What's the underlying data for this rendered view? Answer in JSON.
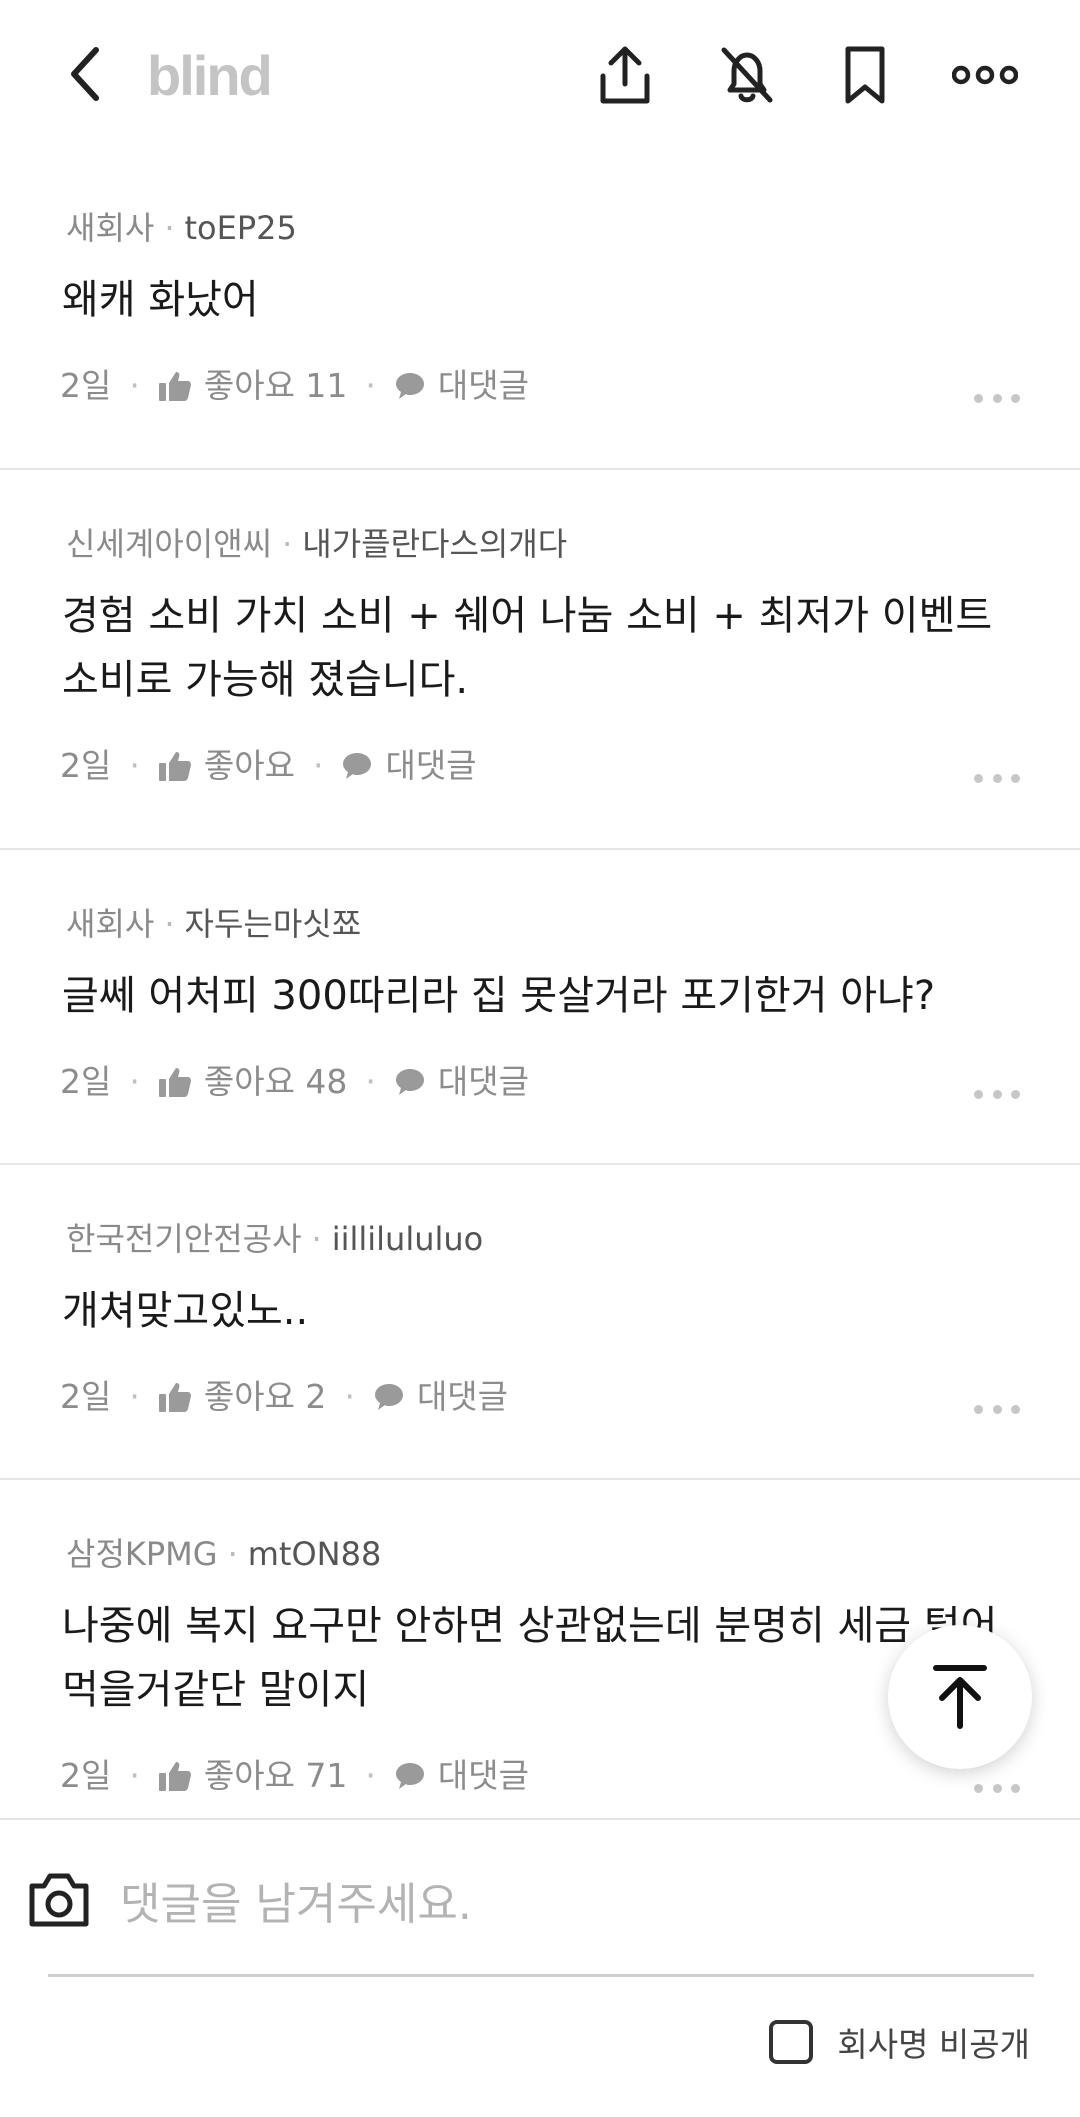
{
  "header": {
    "logo": "blind",
    "icons": [
      "back-arrow-icon",
      "share-icon",
      "bell-off-icon",
      "bookmark-icon",
      "more-icon"
    ]
  },
  "comments": [
    {
      "company": "새회사",
      "nickname": "toEP25",
      "text": "왜캐 화났어",
      "age": "2일",
      "like_label": "좋아요 11",
      "reply_label": "대댓글"
    },
    {
      "company": "신세계아이앤씨",
      "nickname": "내가플란다스의개다",
      "text": "경험 소비 가치 소비 + 쉐어 나눔 소비 + 최저가 이벤트 소비로 가능해 졌습니다.",
      "age": "2일",
      "like_label": "좋아요",
      "reply_label": "대댓글"
    },
    {
      "company": "새회사",
      "nickname": "자두는마싯쬬",
      "text": "글쎄 어처피 300따리라 집 못살거라 포기한거 아냐?",
      "age": "2일",
      "like_label": "좋아요 48",
      "reply_label": "대댓글"
    },
    {
      "company": "한국전기안전공사",
      "nickname": "iillilululuo",
      "text": "개쳐맞고있노..",
      "age": "2일",
      "like_label": "좋아요 2",
      "reply_label": "대댓글"
    },
    {
      "company": "삼정KPMG",
      "nickname": "mtON88",
      "text": "나중에 복지 요구만 안하면 상관없는데 분명히 세금 털어먹을거같단 말이지",
      "age": "2일",
      "like_label": "좋아요 71",
      "reply_label": "대댓글"
    }
  ],
  "reply": {
    "placeholder": "댓글을 남겨주세요.",
    "anonymous_label": "회사명 비공개",
    "anonymous_checked": false
  },
  "colors": {
    "logo": "#c4c4c4",
    "meta": "#8a8a8a",
    "text": "#1a1a1a",
    "divider": "#e6e6e6"
  }
}
